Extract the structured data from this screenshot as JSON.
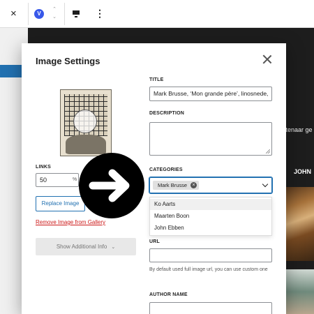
{
  "toolbar": {
    "close_glyph": "×",
    "block_glyph": "V",
    "move_up_glyph": "⌃",
    "move_down_glyph": "⌄",
    "more_glyph": "⋮"
  },
  "background": {
    "text_fragment": "stenaar ge",
    "heading_fragment": "JOHN"
  },
  "dialog": {
    "title": "Image Settings",
    "links": {
      "label": "LINKS",
      "value": "50",
      "unit": "%"
    },
    "replace_label": "Replace Image",
    "remove_label": "Remove Image from Gallery",
    "additional_label": "Show Additional Info",
    "title_field": {
      "label": "TITLE",
      "value": "Mark Brusse, ‘Mon grande père’, linosnede,"
    },
    "description": {
      "label": "DESCRIPTION",
      "value": ""
    },
    "categories": {
      "label": "CATEGORIES",
      "selected": "Mark Brusse",
      "options": [
        "Ko Aarts",
        "Maarten Boon",
        "John Ebben"
      ],
      "highlighted_index": 0
    },
    "url": {
      "label": "URL",
      "value": "",
      "help": "By default used full image url, you can use custom one"
    },
    "author": {
      "label": "AUTHOR NAME",
      "value": ""
    }
  },
  "colors": {
    "accent": "#2271b1",
    "danger": "#cc1818",
    "overlay": "#000000"
  },
  "icons": [
    "close-icon",
    "chevron-down-icon",
    "chip-remove-icon",
    "arrow-right-icon",
    "more-vertical-icon",
    "align-icon"
  ]
}
